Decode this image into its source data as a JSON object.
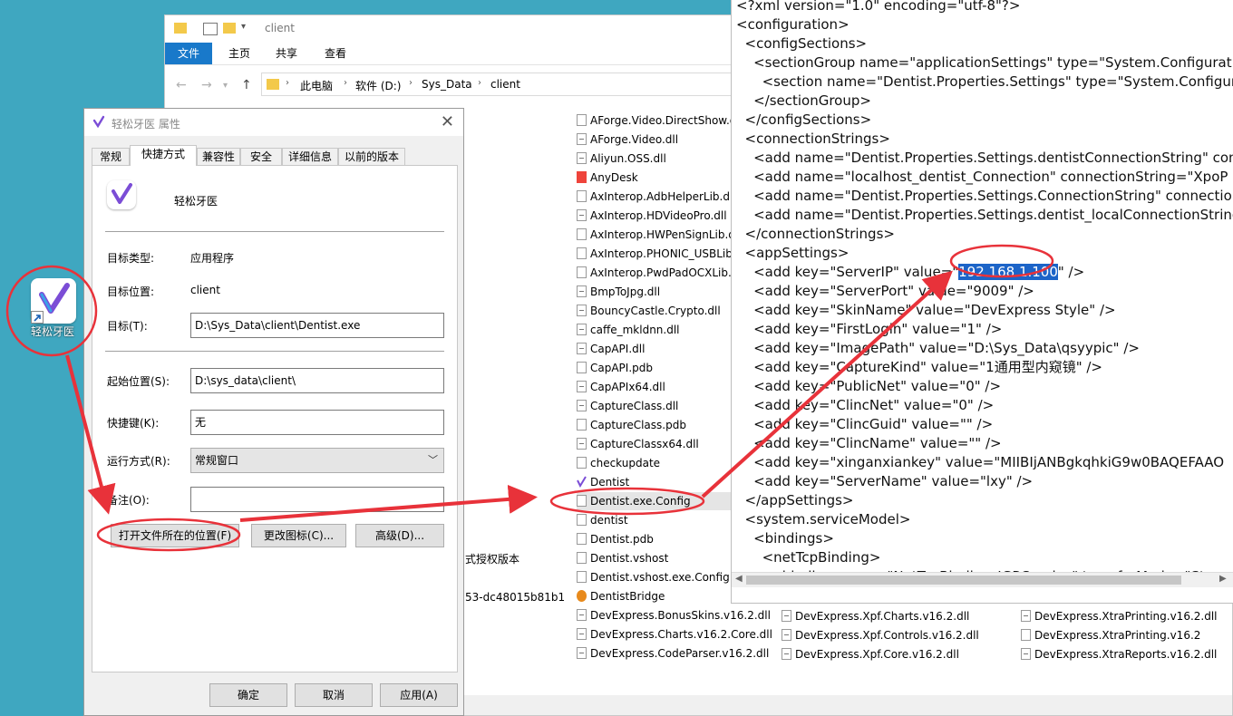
{
  "desktop": {
    "icon_label": "轻松牙医"
  },
  "explorer": {
    "title": "client",
    "ribbon_tabs": [
      "文件",
      "主页",
      "共享",
      "查看"
    ],
    "breadcrumb": [
      "此电脑",
      "软件 (D:)",
      "Sys_Data",
      "client"
    ],
    "files_col1": [
      "AForge.Video.DirectShow.d",
      "AForge.Video.dll",
      "Aliyun.OSS.dll",
      "AnyDesk",
      "AxInterop.AdbHelperLib.dl",
      "AxInterop.HDVideoPro.dll",
      "AxInterop.HWPenSignLib.d",
      "AxInterop.PHONIC_USBLib",
      "AxInterop.PwdPadOCXLib.",
      "BmpToJpg.dll",
      "BouncyCastle.Crypto.dll",
      "caffe_mkldnn.dll",
      "CapAPI.dll",
      "CapAPI.pdb",
      "CapAPIx64.dll",
      "CaptureClass.dll",
      "CaptureClass.pdb",
      "CaptureClassx64.dll",
      "checkupdate",
      "Dentist",
      "Dentist.exe.Config",
      "dentist",
      "Dentist.pdb",
      "Dentist.vshost",
      "Dentist.vshost.exe.Config",
      "DentistBridge",
      "DevExpress.BonusSkins.v16.2.dll",
      "DevExpress.Charts.v16.2.Core.dll",
      "DevExpress.CodeParser.v16.2.dll"
    ],
    "files_col2": [
      "DevExpress.Xpf.Charts.v16.2.dll",
      "DevExpress.Xpf.Controls.v16.2.dll",
      "DevExpress.Xpf.Core.v16.2.dll"
    ],
    "files_col3": [
      "DevExpress.XtraPrinting.v16.2.dll",
      "DevExpress.XtraPrinting.v16.2",
      "DevExpress.XtraReports.v16.2.dll"
    ],
    "left_fragments": {
      "license": "式授权版本",
      "guid": "53-dc48015b81b1"
    }
  },
  "editor": {
    "lines": [
      "<?xml version=\"1.0\" encoding=\"utf-8\"?>",
      "<configuration>",
      "  <configSections>",
      "    <sectionGroup name=\"applicationSettings\" type=\"System.Configuration",
      "      <section name=\"Dentist.Properties.Settings\" type=\"System.Configuration",
      "    </sectionGroup>",
      "  </configSections>",
      "  <connectionStrings>",
      "    <add name=\"Dentist.Properties.Settings.dentistConnectionString\" con",
      "    <add name=\"localhost_dentist_Connection\" connectionString=\"XpoP",
      "    <add name=\"Dentist.Properties.Settings.ConnectionString\" connectio",
      "    <add name=\"Dentist.Properties.Settings.dentist_localConnectionString",
      "  </connectionStrings>",
      "  <appSettings>",
      "    <add key=\"ServerIP\" value=\"",
      "    <add key=\"ServerPort\" value=\"9009\" />",
      "    <add key=\"SkinName\" value=\"DevExpress Style\" />",
      "    <add key=\"FirstLogin\" value=\"1\" />",
      "    <add key=\"ImagePath\" value=\"D:\\Sys_Data\\qsyypic\" />",
      "    <add key=\"CaptureKind\" value=\"1通用型内窥镜\" />",
      "    <add key=\"PublicNet\" value=\"0\" />",
      "    <add key=\"ClincNet\" value=\"0\" />",
      "    <add key=\"ClincGuid\" value=\"\" />",
      "    <add key=\"ClincName\" value=\"\" />",
      "    <add key=\"xinganxiankey\" value=\"MIIBIjANBgkqhkiG9w0BAQEFAAO",
      "    <add key=\"ServerName\" value=\"lxy\" />",
      "  </appSettings>",
      "  <system.serviceModel>",
      "    <bindings>",
      "      <netTcpBinding>",
      "        <binding name=\"NetTcpBinding_IGRService\" transferMode=\"Strea"
    ],
    "server_ip": "192.168.1.100",
    "server_ip_suffix": "\" />"
  },
  "dialog": {
    "title": "轻松牙医 属性",
    "tabs": [
      "常规",
      "快捷方式",
      "兼容性",
      "安全",
      "详细信息",
      "以前的版本"
    ],
    "app_name": "轻松牙医",
    "target_type_label": "目标类型:",
    "target_type_value": "应用程序",
    "target_location_label": "目标位置:",
    "target_location_value": "client",
    "target_label": "目标(T):",
    "target_value": "D:\\Sys_Data\\client\\Dentist.exe",
    "start_in_label": "起始位置(S):",
    "start_in_value": "D:\\sys_data\\client\\",
    "shortcut_key_label": "快捷键(K):",
    "shortcut_key_value": "无",
    "run_label": "运行方式(R):",
    "run_value": "常规窗口",
    "comment_label": "备注(O):",
    "comment_value": "",
    "open_location_button": "打开文件所在的位置(F)",
    "change_icon_button": "更改图标(C)...",
    "advanced_button": "高级(D)...",
    "ok_button": "确定",
    "cancel_button": "取消",
    "apply_button": "应用(A)"
  },
  "colors": {
    "annotation_red": "#e8323a",
    "selection_blue": "#1c64c8",
    "ribbon_blue": "#1979ca",
    "desktop": "#3fa7c0"
  }
}
